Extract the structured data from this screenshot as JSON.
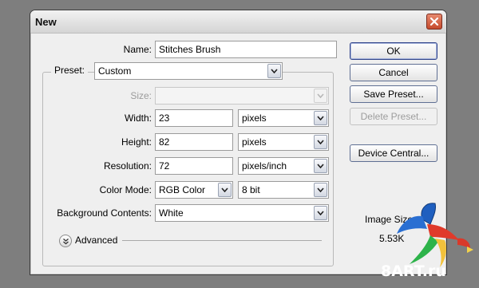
{
  "dialog": {
    "title": "New"
  },
  "form": {
    "name_label": "Name:",
    "name_value": "Stitches Brush",
    "preset_label": "Preset:",
    "preset_value": "Custom",
    "size_label": "Size:",
    "size_value": "",
    "width_label": "Width:",
    "width_value": "23",
    "width_unit": "pixels",
    "height_label": "Height:",
    "height_value": "82",
    "height_unit": "pixels",
    "resolution_label": "Resolution:",
    "resolution_value": "72",
    "resolution_unit": "pixels/inch",
    "color_mode_label": "Color Mode:",
    "color_mode_value": "RGB Color",
    "bit_depth_value": "8 bit",
    "background_label": "Background Contents:",
    "background_value": "White",
    "advanced_label": "Advanced"
  },
  "buttons": {
    "ok": "OK",
    "cancel": "Cancel",
    "save_preset": "Save Preset...",
    "delete_preset": "Delete Preset...",
    "device_central": "Device Central..."
  },
  "image_size": {
    "label": "Image Size:",
    "value": "5.53K"
  },
  "watermark": {
    "text": "8ART.ru"
  },
  "icons": {
    "close": "close-icon",
    "dropdown": "chevron-down-icon",
    "advanced": "double-chevron-down-icon",
    "parrot": "parrot-logo"
  },
  "colors": {
    "close_button": "#c54a2c",
    "dialog_bg": "#efefef",
    "backdrop": "#7e7e7e"
  }
}
